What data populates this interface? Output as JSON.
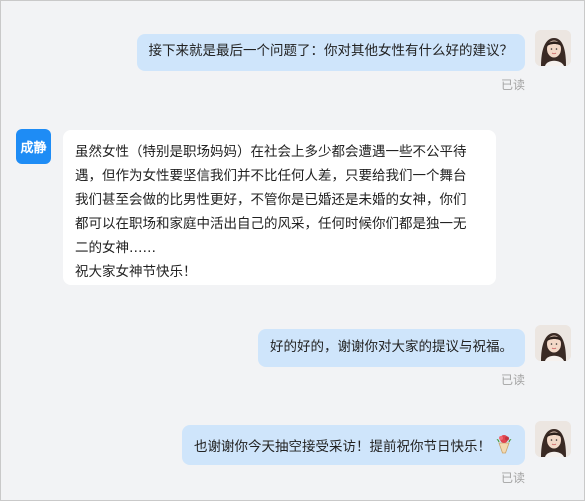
{
  "messages": [
    {
      "sender": "me",
      "text": "接下来就是最后一个问题了：你对其他女性有什么好的建议？",
      "status": "已读"
    },
    {
      "sender": "them",
      "avatar_label": "成静",
      "lines": [
        "虽然女性（特别是职场妈妈）在社会上多少都会遭遇一些不公平待",
        "遇，但作为女性要坚信我们并不比任何人差，只要给我们一个舞台",
        "我们甚至会做的比男性更好，不管你是已婚还是未婚的女神，你们",
        "都可以在职场和家庭中活出自己的风采，任何时候你们都是独一无",
        "二的女神……",
        "祝大家女神节快乐！"
      ]
    },
    {
      "sender": "me",
      "text": "好的好的，谢谢你对大家的提议与祝福。",
      "status": "已读"
    },
    {
      "sender": "me",
      "text": "也谢谢你今天抽空接受采访！提前祝你节日快乐！",
      "emoji": "bouquet-emoji",
      "status": "已读"
    }
  ],
  "colors": {
    "background": "#f2f3f5",
    "my_bubble": "#cfe5fb",
    "their_bubble": "#ffffff",
    "contact_avatar": "#1e8cf5",
    "read_status": "#a3a3a3"
  }
}
